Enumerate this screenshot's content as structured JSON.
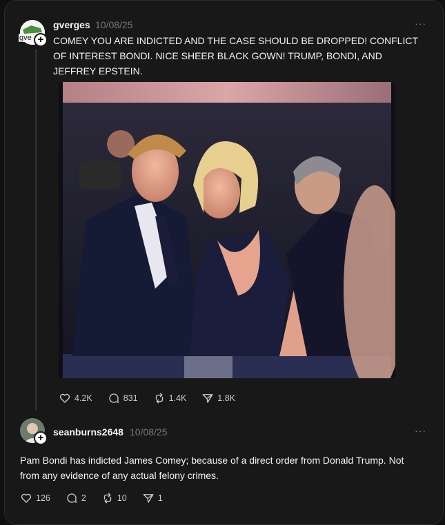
{
  "posts": [
    {
      "username": "gverges",
      "avatar_text": "gve",
      "date": "10/08/25",
      "more": "···",
      "text_lines": [
        "COMEY YOU ARE INDICTED AND THE CASE SHOULD BE DROPPED! CONFLICT",
        "OF INTEREST BONDI. NICE SHEER BLACK GOWN! TRUMP, BONDI, AND",
        "JEFFREY EPSTEIN."
      ],
      "stats": {
        "likes": "4.2K",
        "replies": "831",
        "reposts": "1.4K",
        "shares": "1.8K"
      }
    },
    {
      "username": "seanburns2648",
      "date": "10/08/25",
      "more": "···",
      "text_lines": [
        "Pam Bondi has indicted James Comey; because of a direct order from Donald Trump. Not",
        "from any evidence of any actual felony crimes."
      ],
      "stats": {
        "likes": "126",
        "replies": "2",
        "reposts": "10",
        "shares": "1"
      }
    }
  ],
  "icons": {
    "like": "heart-icon",
    "reply": "comment-icon",
    "repost": "repost-icon",
    "share": "send-icon",
    "follow": "plus-icon"
  },
  "colors": {
    "background": "#101010",
    "panel": "#181818",
    "text": "#f3f5f7",
    "muted": "#777777"
  }
}
